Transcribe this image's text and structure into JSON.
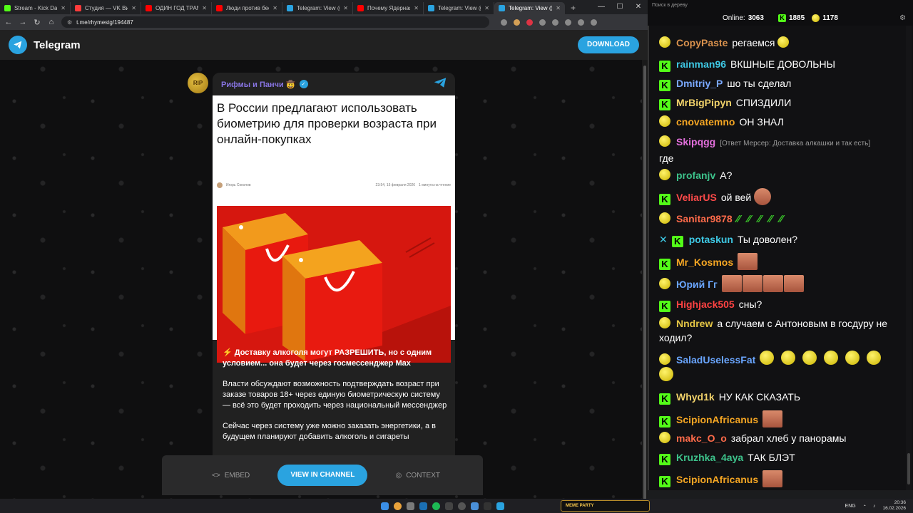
{
  "browser": {
    "tabs": [
      {
        "title": "Stream - Kick Dashboard",
        "color": "#53fc18"
      },
      {
        "title": "Студия — VK Видео Live",
        "color": "#ff3b3b"
      },
      {
        "title": "ОДИН ГОД ТРАМПА",
        "color": "#ff0000"
      },
      {
        "title": "Люди против бестиарий",
        "color": "#ff0000"
      },
      {
        "title": "Telegram: View @dobrii",
        "color": "#2aa3e0"
      },
      {
        "title": "Почему Ядерная война",
        "color": "#ff0000"
      },
      {
        "title": "Telegram: View @grgcu",
        "color": "#2aa3e0"
      },
      {
        "title": "Telegram: View @rhyme",
        "color": "#2aa3e0",
        "active": true
      }
    ],
    "url": "t.me/rhymestg/194487"
  },
  "telegram": {
    "brand": "Telegram",
    "download_label": "DOWNLOAD",
    "avatar_text": "RIP",
    "channel_name": "Рифмы и Панчи 🤠",
    "article": {
      "title": "В России предлагают использовать биометрию для проверки возраста при онлайн-покупках",
      "author": "Игорь Соколов",
      "date": "23:54, 15 февраля 2026",
      "read_time": "1 минута на чтение"
    },
    "post": {
      "lead": "⚡ Доставку алкоголя могут РАЗРЕШИТЬ, но с одним условием... она будет через госмессенджер Max",
      "p2": "Власти обсуждают возможность подтверждать возраст при заказе товаров 18+ через единую биометрическую систему — всё это будет проходить через национальный мессенджер",
      "p3": "Сейчас через систему уже можно заказать энергетики, а в будущем планируют добавить алкоголь и сигареты"
    },
    "bottom": {
      "embed": "EMBED",
      "view": "VIEW IN CHANNEL",
      "context": "CONTEXT"
    }
  },
  "chat": {
    "search_placeholder": "Поиск в дереву",
    "online_label": "Online:",
    "online_count": "3063",
    "stat_kick": "1885",
    "stat_other": "1178",
    "messages": [
      {
        "badge": "ball",
        "name": "CopyPaste",
        "color": "#d9914d",
        "text": "регаемся"
      },
      {
        "badge": "k",
        "name": "rainman96",
        "color": "#3ec8e4",
        "text": "ВКШНЫЕ ДОВОЛЬНЫ"
      },
      {
        "badge": "k",
        "name": "Dmitriy_P",
        "color": "#7aa9ff",
        "text": "шо ты сделал"
      },
      {
        "badge": "k",
        "name": "MrBigPipyn",
        "color": "#f1d26a",
        "text": "СПИЗДИЛИ"
      },
      {
        "badge": "ball",
        "name": "cnovatemno",
        "color": "#f5a623",
        "text": "ОН ЗНАЛ"
      },
      {
        "badge": "ball",
        "name": "Skipqgg",
        "color": "#e36fdc",
        "reply": "[Ответ Мерсер: Доставка алкашки и так есть]",
        "text": "где"
      },
      {
        "badge": "ball",
        "name": "profanjv",
        "color": "#3dc28b",
        "text": "А?"
      },
      {
        "badge": "k",
        "name": "VeliarUS",
        "color": "#ff4a4a",
        "text": "ой вей"
      },
      {
        "badge": "ball",
        "name": "Sanitar9878",
        "color": "#ff6b4a",
        "text": ""
      },
      {
        "badge": "k",
        "name": "potaskun",
        "color": "#3ec8e4",
        "text": "Ты доволен?"
      },
      {
        "badge": "k",
        "name": "Mr_Kosmos",
        "color": "#f5a623",
        "text": ""
      },
      {
        "badge": "ball",
        "name": "Юрий Гг",
        "color": "#6aa6ff",
        "text": ""
      },
      {
        "badge": "k",
        "name": "Highjack505",
        "color": "#ff4242",
        "text": "сны?"
      },
      {
        "badge": "ball",
        "name": "Nndrew",
        "color": "#e5c645",
        "text": "а случаем с Антоновым в госдуру не ходил?"
      },
      {
        "badge": "ball",
        "name": "SaladUselessFat",
        "color": "#6aa6ff",
        "text": ""
      },
      {
        "badge": "k",
        "name": "Whyd1k",
        "color": "#f1d26a",
        "text": "НУ КАК СКАЗАТЬ"
      },
      {
        "badge": "k",
        "name": "ScipionAfricanus",
        "color": "#f5a623",
        "text": ""
      },
      {
        "badge": "ball",
        "name": "makc_O_o",
        "color": "#ff6b4a",
        "text": "забрал хлеб у панорамы"
      },
      {
        "badge": "k",
        "name": "Kruzhka_4aya",
        "color": "#3dc28b",
        "text": "ТАК БЛЭТ"
      },
      {
        "badge": "k",
        "name": "ScipionAfricanus",
        "color": "#f5a623",
        "text": ""
      }
    ]
  },
  "taskbar": {
    "memes_label": "MEME PARTY",
    "lang": "ENG",
    "time": "20:36",
    "date": "16.02.2026"
  }
}
